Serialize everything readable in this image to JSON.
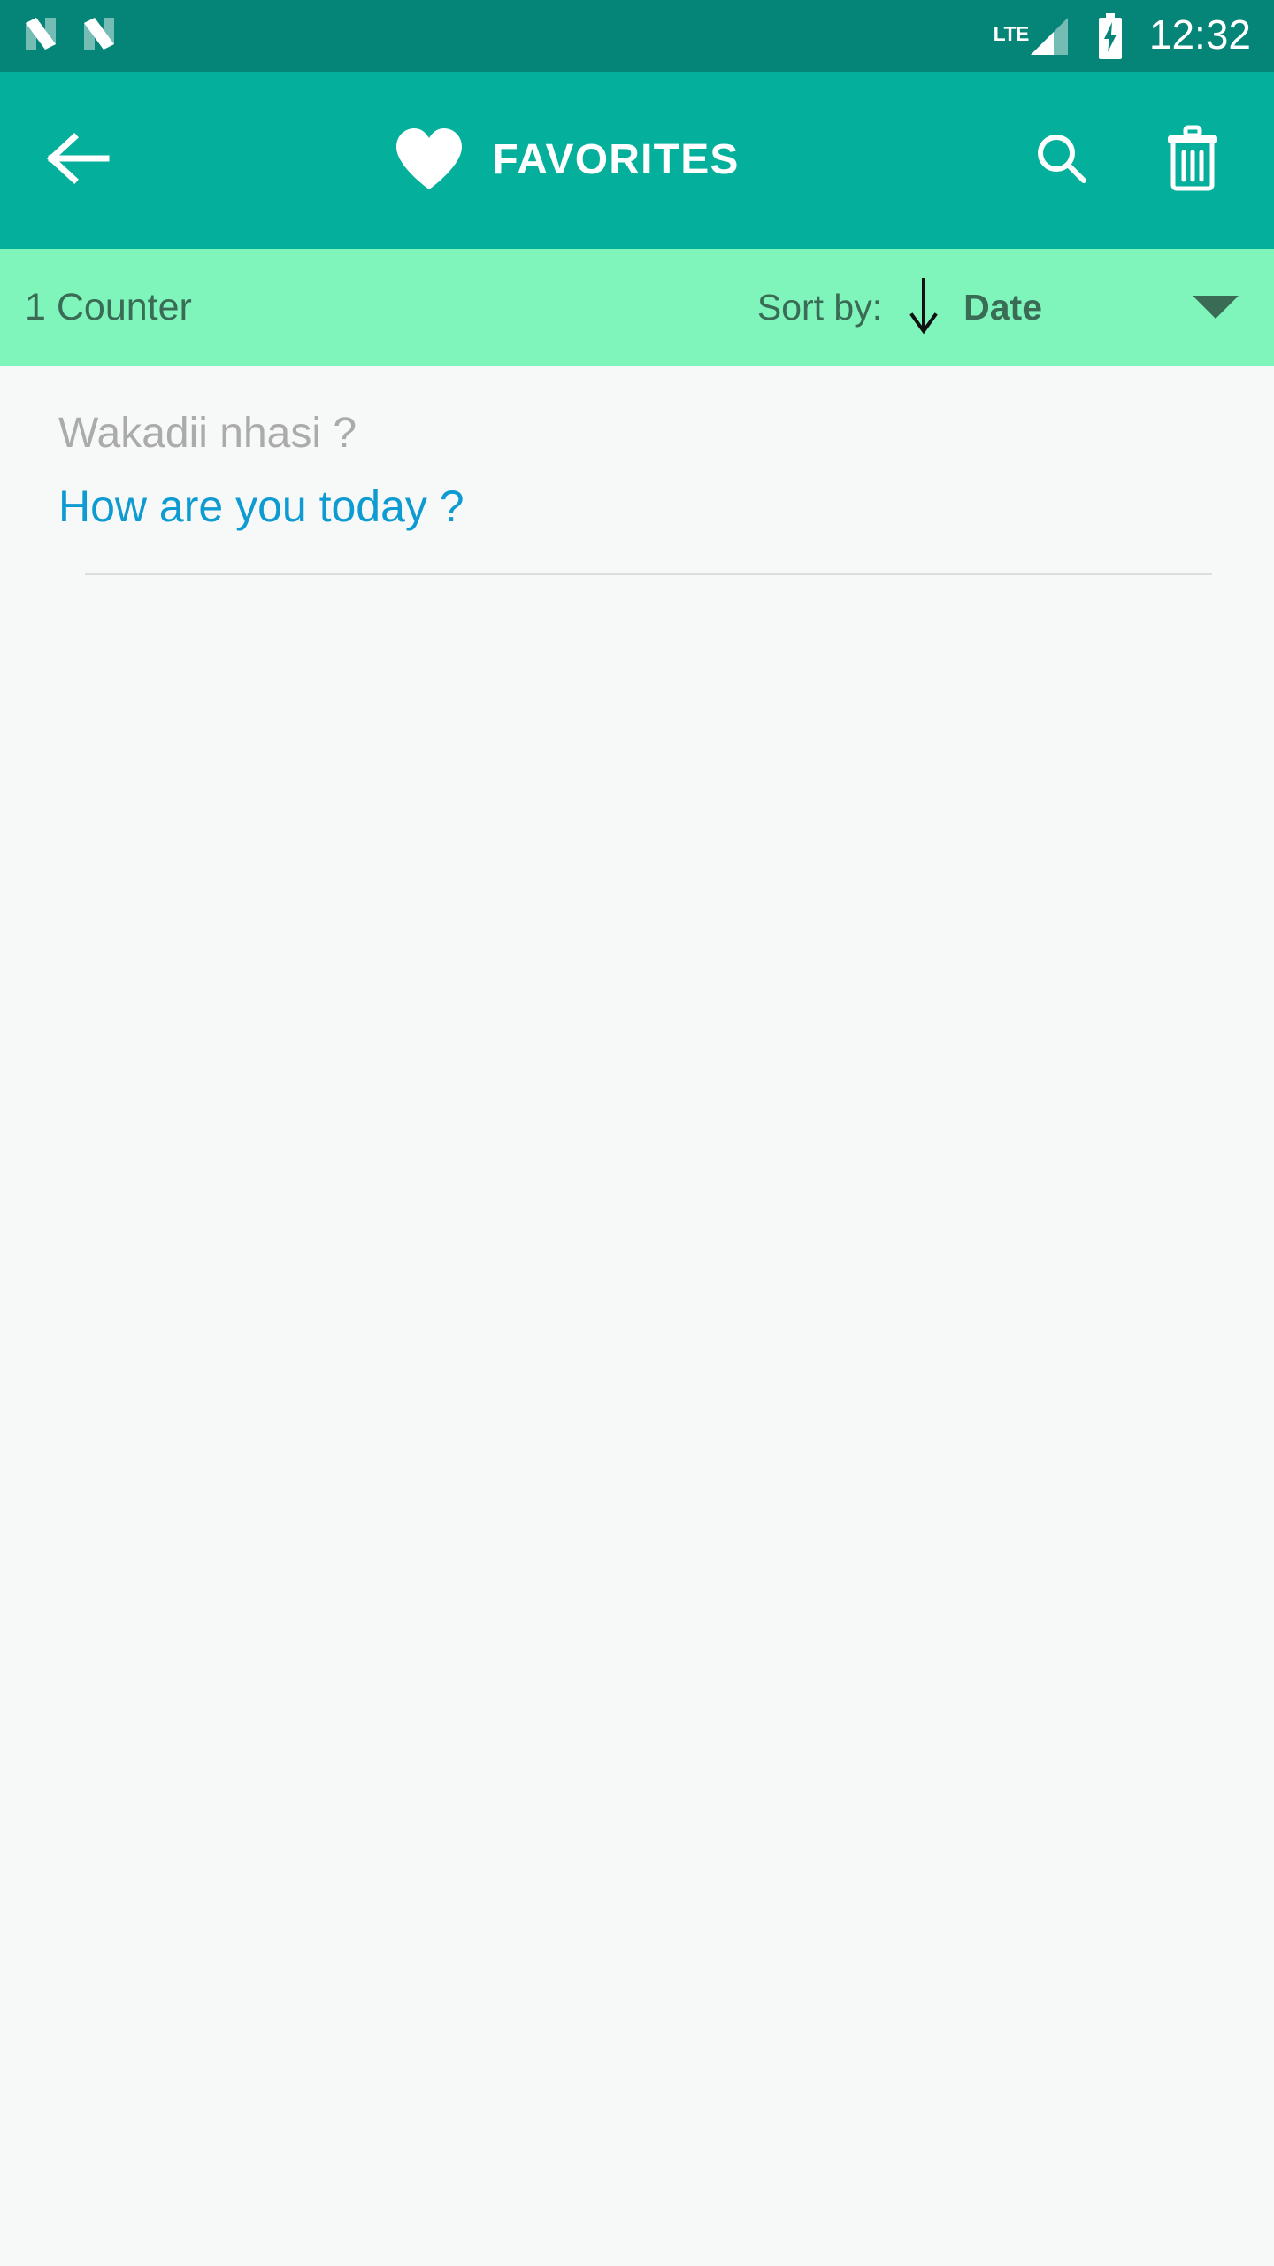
{
  "status_bar": {
    "notification_icons": [
      "n-logo-icon",
      "n-logo-icon"
    ],
    "network_label": "LTE",
    "signal_icon": "signal-bars-icon",
    "battery_icon": "battery-charging-icon",
    "time": "12:32",
    "background_color": "#048578",
    "foreground_color": "#FFFFFF"
  },
  "app_bar": {
    "back_icon": "arrow-left-icon",
    "heart_icon": "heart-filled-icon",
    "title": "FAVORITES",
    "search_icon": "search-icon",
    "delete_icon": "trash-icon",
    "background_color": "#04B09B",
    "foreground_color": "#FFFFFF"
  },
  "sort_bar": {
    "counter_text": "1 Counter",
    "sort_label": "Sort by:",
    "sort_direction_icon": "arrow-down-icon",
    "sort_value": "Date",
    "dropdown_icon": "caret-down-icon",
    "background_color": "#7FF5BC",
    "text_color": "#3A6B55"
  },
  "list": {
    "items": [
      {
        "source_text": "Wakadii nhasi ?",
        "translation_text": "How are you today ?",
        "source_color": "#ABABAB",
        "translation_color": "#0D9BD1"
      }
    ]
  },
  "content": {
    "background_color": "#F7F8F8",
    "divider_color": "#DCDDDE"
  }
}
